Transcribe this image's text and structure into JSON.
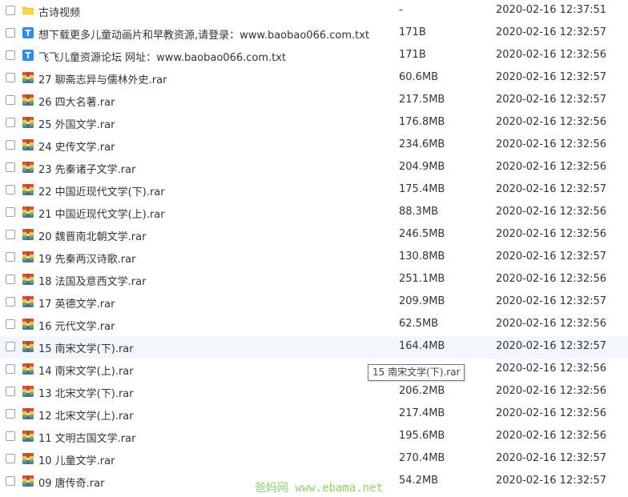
{
  "rows": [
    {
      "type": "folder",
      "name": "古诗视频",
      "size": "-",
      "date": "2020-02-16 12:37:51"
    },
    {
      "type": "txt",
      "name": "想下载更多儿童动画片和早教资源,请登录：www.baobao066.com.txt",
      "size": "171B",
      "date": "2020-02-16 12:32:57"
    },
    {
      "type": "txt",
      "name": "飞飞儿童资源论坛 网址：www.baobao066.com.txt",
      "size": "171B",
      "date": "2020-02-16 12:32:56"
    },
    {
      "type": "rar",
      "name": "27 聊斋志异与儒林外史.rar",
      "size": "60.6MB",
      "date": "2020-02-16 12:32:57"
    },
    {
      "type": "rar",
      "name": "26 四大名著.rar",
      "size": "217.5MB",
      "date": "2020-02-16 12:32:57"
    },
    {
      "type": "rar",
      "name": "25 外国文学.rar",
      "size": "176.8MB",
      "date": "2020-02-16 12:32:56"
    },
    {
      "type": "rar",
      "name": "24 史传文学.rar",
      "size": "234.6MB",
      "date": "2020-02-16 12:32:56"
    },
    {
      "type": "rar",
      "name": "23 先秦诸子文学.rar",
      "size": "204.9MB",
      "date": "2020-02-16 12:32:56"
    },
    {
      "type": "rar",
      "name": "22 中国近现代文学(下).rar",
      "size": "175.4MB",
      "date": "2020-02-16 12:32:57"
    },
    {
      "type": "rar",
      "name": "21 中国近现代文学(上).rar",
      "size": "88.3MB",
      "date": "2020-02-16 12:32:56"
    },
    {
      "type": "rar",
      "name": "20 魏晋南北朝文学.rar",
      "size": "246.5MB",
      "date": "2020-02-16 12:32:56"
    },
    {
      "type": "rar",
      "name": "19 先秦两汉诗歌.rar",
      "size": "130.8MB",
      "date": "2020-02-16 12:32:57"
    },
    {
      "type": "rar",
      "name": "18 法国及意西文学.rar",
      "size": "251.1MB",
      "date": "2020-02-16 12:32:56"
    },
    {
      "type": "rar",
      "name": "17 英德文学.rar",
      "size": "209.9MB",
      "date": "2020-02-16 12:32:57"
    },
    {
      "type": "rar",
      "name": "16 元代文学.rar",
      "size": "62.5MB",
      "date": "2020-02-16 12:32:56"
    },
    {
      "type": "rar",
      "name": "15 南宋文学(下).rar",
      "size": "164.4MB",
      "date": "2020-02-16 12:32:57",
      "hover": true
    },
    {
      "type": "rar",
      "name": "14 南宋文学(上).rar",
      "size": "",
      "date": "2020-02-16 12:32:56"
    },
    {
      "type": "rar",
      "name": "13 北宋文学(下).rar",
      "size": "206.2MB",
      "date": "2020-02-16 12:32:56"
    },
    {
      "type": "rar",
      "name": "12 北宋文学(上).rar",
      "size": "217.4MB",
      "date": "2020-02-16 12:32:56"
    },
    {
      "type": "rar",
      "name": "11 文明古国文学.rar",
      "size": "195.6MB",
      "date": "2020-02-16 12:32:56"
    },
    {
      "type": "rar",
      "name": "10 儿童文学.rar",
      "size": "270.4MB",
      "date": "2020-02-16 12:32:57"
    },
    {
      "type": "rar",
      "name": "09 唐传奇.rar",
      "size": "54.2MB",
      "date": "2020-02-16 12:32:57"
    }
  ],
  "tooltip": "15 南宋文学(下).rar",
  "watermark": "爸妈网 www.ebama.net",
  "icons": {
    "folder": "folder-icon",
    "txt": "text-file-icon",
    "rar": "archive-icon"
  },
  "colors": {
    "folder": "#f7c32e",
    "txt": "#2d8cf0",
    "rar_blue": "#3b7ad8",
    "rar_yellow": "#f5c342",
    "rar_red": "#e84b3c",
    "rar_green": "#5ab95a",
    "hover_row": "#f2f7fd",
    "watermark": "#8fd16a"
  }
}
